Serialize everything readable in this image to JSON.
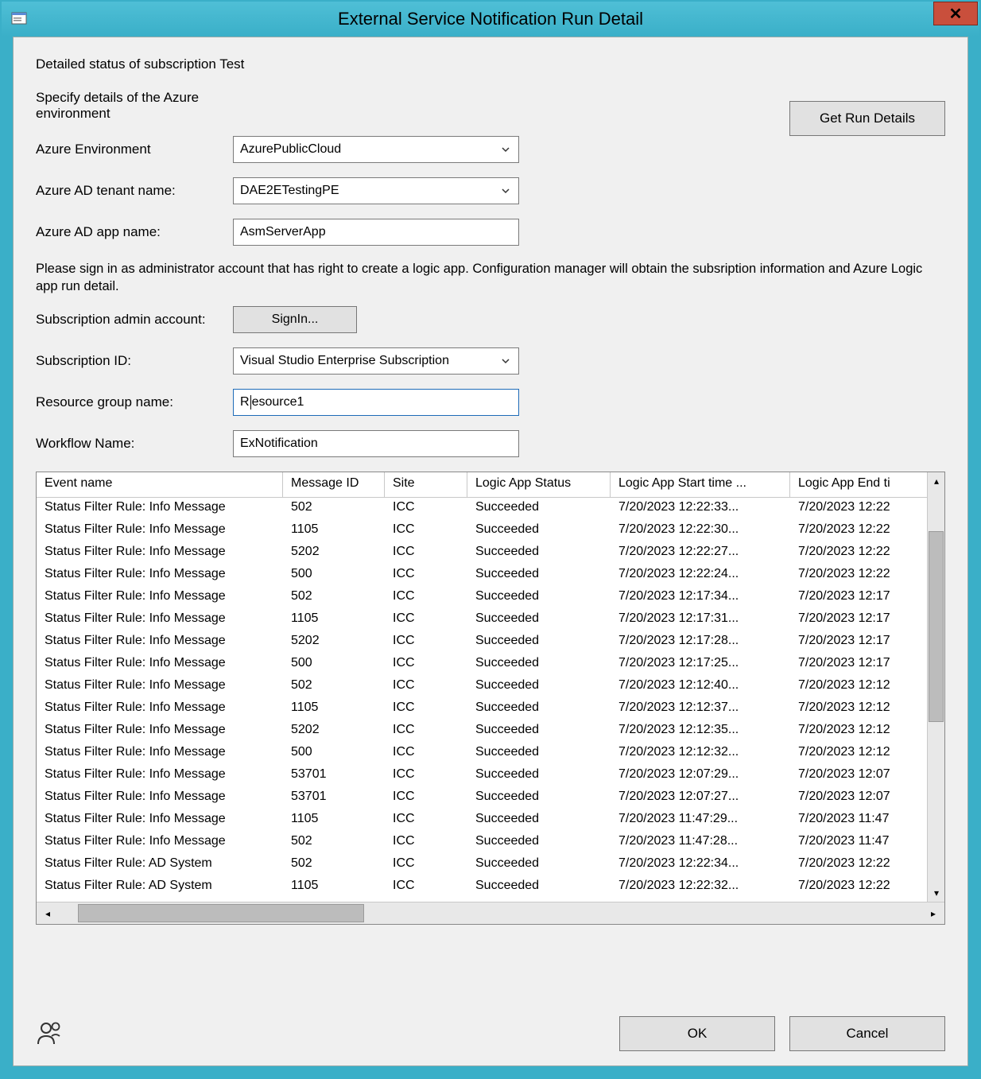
{
  "window": {
    "title": "External Service Notification Run Detail"
  },
  "heading": "Detailed status of subscription Test",
  "azure_section_label": "Specify details of the Azure environment",
  "get_run_details_label": "Get Run Details",
  "labels": {
    "azure_env": "Azure Environment",
    "ad_tenant": "Azure AD tenant name:",
    "ad_app": "Azure AD app name:",
    "sub_admin": "Subscription admin account:",
    "sub_id": "Subscription ID:",
    "rg_name": "Resource group name:",
    "wf_name": "Workflow Name:"
  },
  "fields": {
    "azure_env": "AzurePublicCloud",
    "ad_tenant": "DAE2ETestingPE",
    "ad_app": "AsmServerApp",
    "sub_id": "Visual Studio Enterprise Subscription",
    "rg_name_prefix": "R",
    "rg_name_suffix": "esource1",
    "wf_name": "ExNotification"
  },
  "signin_label": "SignIn...",
  "instructions": "Please sign in as administrator account that has right to create a logic app. Configuration manager will obtain the subsription information and Azure Logic app run detail.",
  "table": {
    "headers": {
      "event": "Event name",
      "msg": "Message ID",
      "site": "Site",
      "status": "Logic App Status",
      "start": "Logic App Start time ...",
      "end": "Logic App End ti"
    },
    "rows": [
      {
        "event": "Status Filter Rule: Info Message",
        "msg": "502",
        "site": "ICC",
        "status": "Succeeded",
        "start": "7/20/2023 12:22:33...",
        "end": "7/20/2023 12:22"
      },
      {
        "event": "Status Filter Rule: Info Message",
        "msg": "1105",
        "site": "ICC",
        "status": "Succeeded",
        "start": "7/20/2023 12:22:30...",
        "end": "7/20/2023 12:22"
      },
      {
        "event": "Status Filter Rule: Info Message",
        "msg": "5202",
        "site": "ICC",
        "status": "Succeeded",
        "start": "7/20/2023 12:22:27...",
        "end": "7/20/2023 12:22"
      },
      {
        "event": "Status Filter Rule: Info Message",
        "msg": "500",
        "site": "ICC",
        "status": "Succeeded",
        "start": "7/20/2023 12:22:24...",
        "end": "7/20/2023 12:22"
      },
      {
        "event": "Status Filter Rule: Info Message",
        "msg": "502",
        "site": "ICC",
        "status": "Succeeded",
        "start": "7/20/2023 12:17:34...",
        "end": "7/20/2023 12:17"
      },
      {
        "event": "Status Filter Rule: Info Message",
        "msg": "1105",
        "site": "ICC",
        "status": "Succeeded",
        "start": "7/20/2023 12:17:31...",
        "end": "7/20/2023 12:17"
      },
      {
        "event": "Status Filter Rule: Info Message",
        "msg": "5202",
        "site": "ICC",
        "status": "Succeeded",
        "start": "7/20/2023 12:17:28...",
        "end": "7/20/2023 12:17"
      },
      {
        "event": "Status Filter Rule: Info Message",
        "msg": "500",
        "site": "ICC",
        "status": "Succeeded",
        "start": "7/20/2023 12:17:25...",
        "end": "7/20/2023 12:17"
      },
      {
        "event": "Status Filter Rule: Info Message",
        "msg": "502",
        "site": "ICC",
        "status": "Succeeded",
        "start": "7/20/2023 12:12:40...",
        "end": "7/20/2023 12:12"
      },
      {
        "event": "Status Filter Rule: Info Message",
        "msg": "1105",
        "site": "ICC",
        "status": "Succeeded",
        "start": "7/20/2023 12:12:37...",
        "end": "7/20/2023 12:12"
      },
      {
        "event": "Status Filter Rule: Info Message",
        "msg": "5202",
        "site": "ICC",
        "status": "Succeeded",
        "start": "7/20/2023 12:12:35...",
        "end": "7/20/2023 12:12"
      },
      {
        "event": "Status Filter Rule: Info Message",
        "msg": "500",
        "site": "ICC",
        "status": "Succeeded",
        "start": "7/20/2023 12:12:32...",
        "end": "7/20/2023 12:12"
      },
      {
        "event": "Status Filter Rule: Info Message",
        "msg": "53701",
        "site": "ICC",
        "status": "Succeeded",
        "start": "7/20/2023 12:07:29...",
        "end": "7/20/2023 12:07"
      },
      {
        "event": "Status Filter Rule: Info Message",
        "msg": "53701",
        "site": "ICC",
        "status": "Succeeded",
        "start": "7/20/2023 12:07:27...",
        "end": "7/20/2023 12:07"
      },
      {
        "event": "Status Filter Rule: Info Message",
        "msg": "1105",
        "site": "ICC",
        "status": "Succeeded",
        "start": "7/20/2023 11:47:29...",
        "end": "7/20/2023 11:47"
      },
      {
        "event": "Status Filter Rule: Info Message",
        "msg": "502",
        "site": "ICC",
        "status": "Succeeded",
        "start": "7/20/2023 11:47:28...",
        "end": "7/20/2023 11:47"
      },
      {
        "event": "Status Filter Rule: AD System",
        "msg": "502",
        "site": "ICC",
        "status": "Succeeded",
        "start": "7/20/2023 12:22:34...",
        "end": "7/20/2023 12:22"
      },
      {
        "event": "Status Filter Rule: AD System",
        "msg": "1105",
        "site": "ICC",
        "status": "Succeeded",
        "start": "7/20/2023 12:22:32...",
        "end": "7/20/2023 12:22"
      }
    ]
  },
  "footer": {
    "ok": "OK",
    "cancel": "Cancel"
  }
}
